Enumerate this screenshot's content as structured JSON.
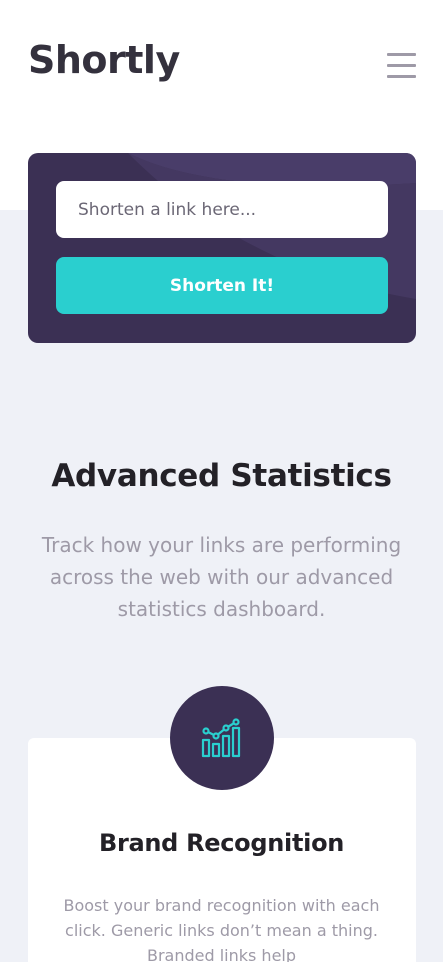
{
  "brand": {
    "logo_text": "Shortly"
  },
  "nav": {
    "menu_icon": "hamburger-menu-icon"
  },
  "shorten_form": {
    "input_placeholder": "Shorten a link here...",
    "input_value": "",
    "button_label": "Shorten It!"
  },
  "stats": {
    "title": "Advanced Statistics",
    "description": "Track how your links are performing across the web with our advanced statistics dashboard."
  },
  "feature_card": {
    "icon": "brand-recognition-chart-icon",
    "title": "Brand Recognition",
    "description": "Boost your brand recognition with each click. Generic links don’t mean a thing. Branded links help"
  },
  "colors": {
    "primary_cyan": "#2acfcf",
    "dark_violet": "#3b3054",
    "gray_bg": "#eff1f7",
    "gray_text": "#9e9aa7",
    "very_dark_text": "#232127"
  }
}
